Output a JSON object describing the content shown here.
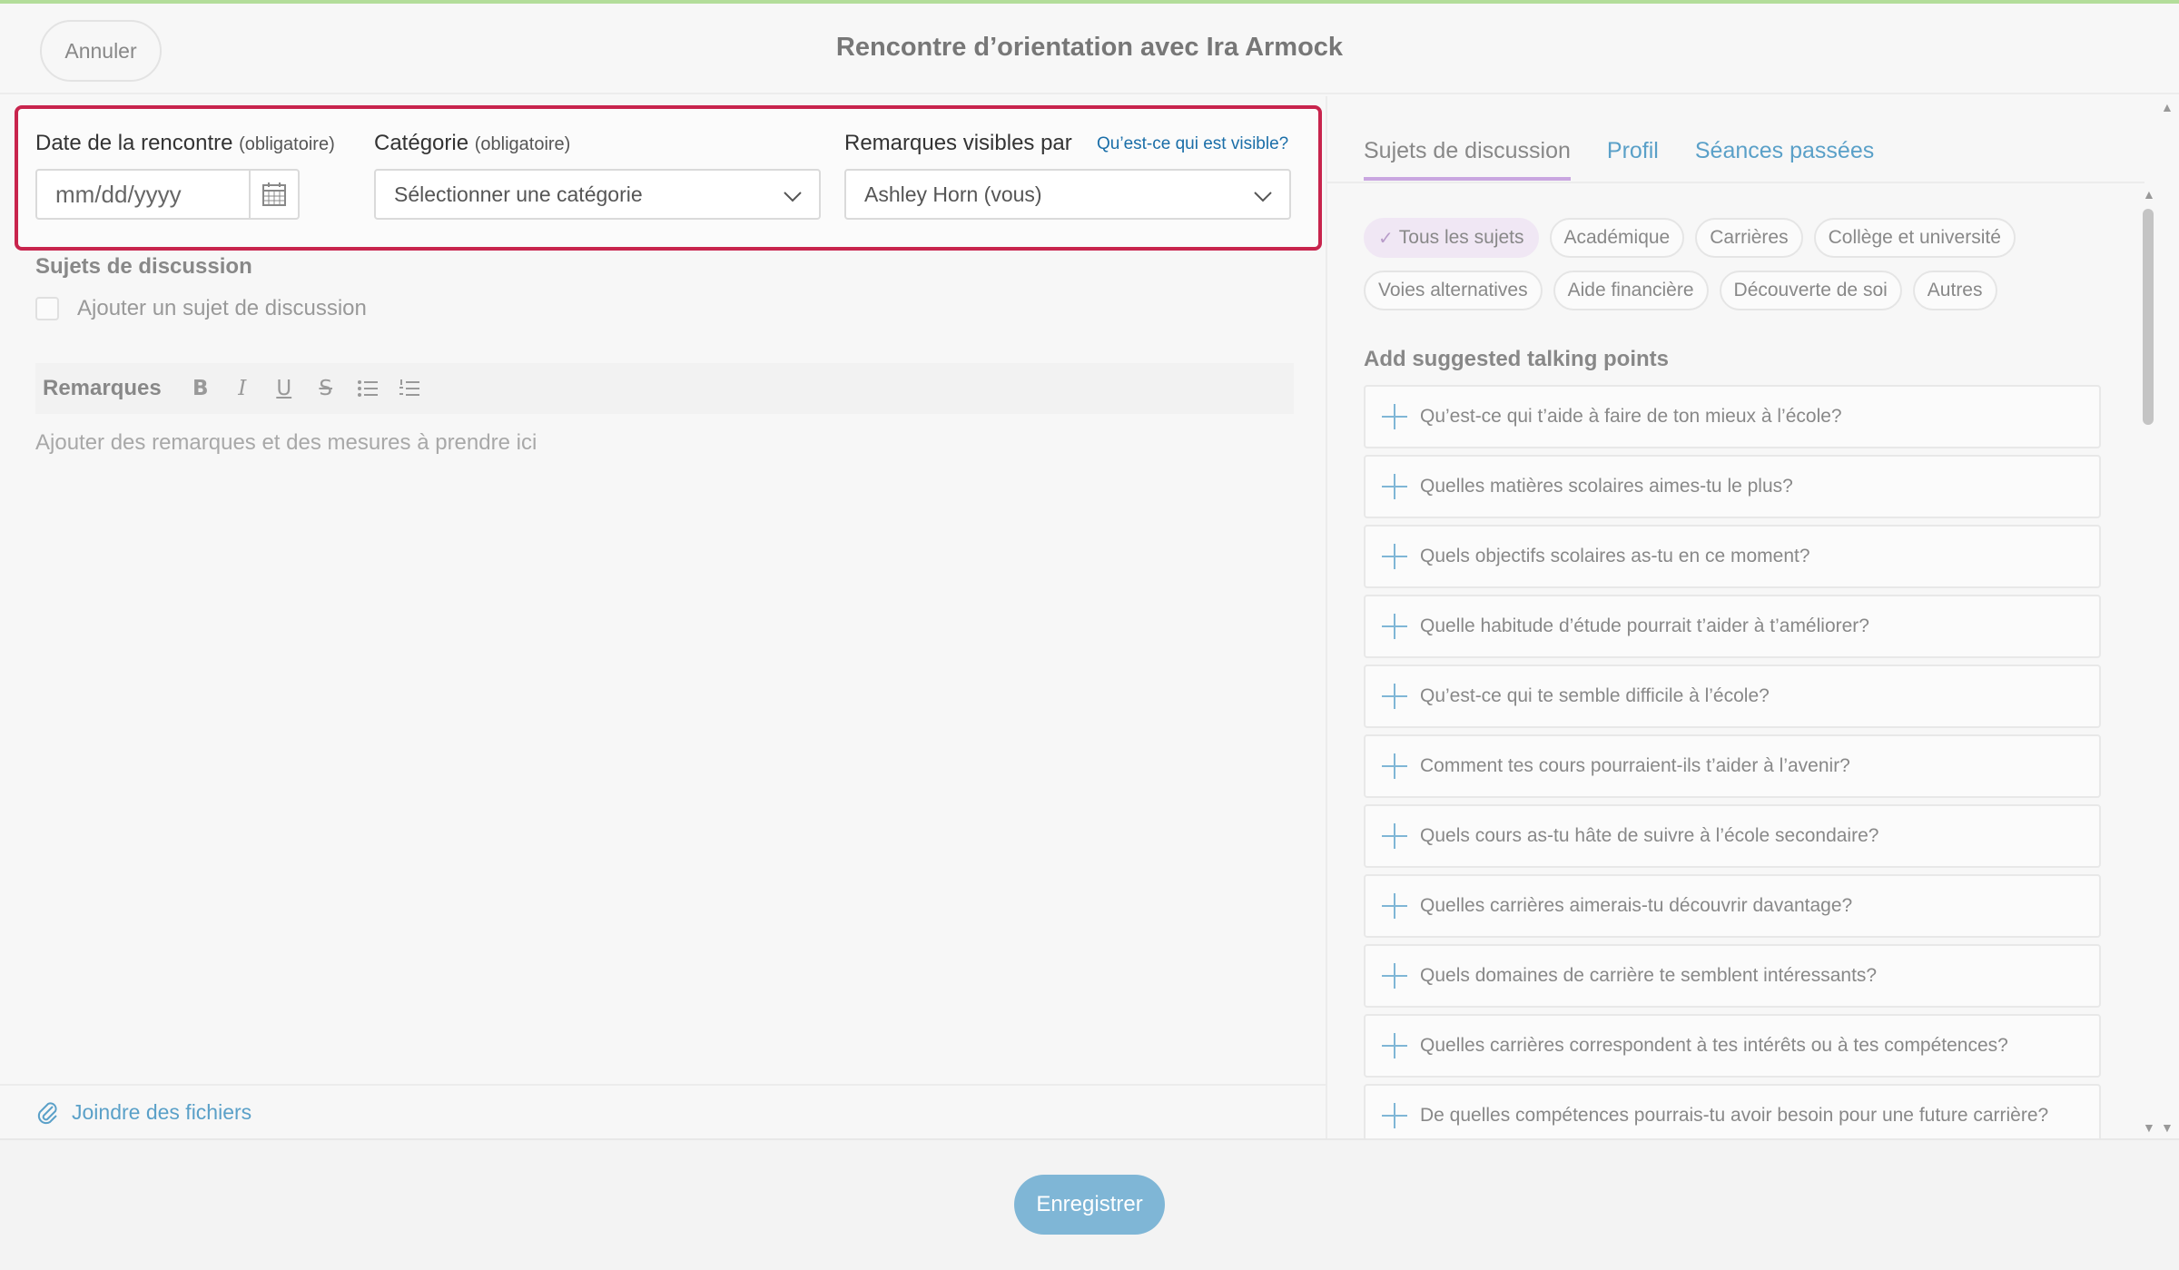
{
  "header": {
    "cancel_label": "Annuler",
    "title": "Rencontre d’orientation avec Ira Armock"
  },
  "form": {
    "date_label": "Date de la rencontre",
    "date_required": "(obligatoire)",
    "date_placeholder": "mm/dd/yyyy",
    "category_label": "Catégorie",
    "category_required": "(obligatoire)",
    "category_value": "Sélectionner une catégorie",
    "visibility_label": "Remarques visibles par",
    "visibility_link": "Qu’est-ce qui est visible?",
    "visibility_value": "Ashley Horn (vous)",
    "accent_color": "#c8244d"
  },
  "topics": {
    "section_label": "Sujets de discussion",
    "add_label": "Ajouter un sujet de discussion"
  },
  "notes": {
    "toolbar_label": "Remarques",
    "toolbar_buttons": {
      "bold": "B",
      "italic": "I",
      "underline": "U",
      "strike": "S"
    },
    "placeholder": "Ajouter des remarques et des mesures à prendre ici"
  },
  "attach": {
    "label": "Joindre des fichiers"
  },
  "right": {
    "tabs": [
      "Sujets de discussion",
      "Profil",
      "Séances passées"
    ],
    "chips": [
      "Tous les sujets",
      "Académique",
      "Carrières",
      "Collège et université",
      "Voies alternatives",
      "Aide financière",
      "Découverte de soi",
      "Autres"
    ],
    "suggest_heading": "Add suggested talking points",
    "suggestions": [
      "Qu’est-ce qui t’aide à faire de ton mieux à l’école?",
      "Quelles matières scolaires aimes-tu le plus?",
      "Quels objectifs scolaires as-tu en ce moment?",
      "Quelle habitude d’étude pourrait t’aider à t’améliorer?",
      "Qu’est-ce qui te semble difficile à l’école?",
      "Comment tes cours pourraient-ils t’aider à l’avenir?",
      "Quels cours as-tu hâte de suivre à l’école secondaire?",
      "Quelles carrières aimerais-tu découvrir davantage?",
      "Quels domaines de carrière te semblent intéressants?",
      "Quelles carrières correspondent à tes intérêts ou à tes compétences?",
      "De quelles compétences pourrais-tu avoir besoin pour une future carrière?"
    ]
  },
  "footer": {
    "save_label": "Enregistrer",
    "save_color": "#7fb6d6"
  }
}
